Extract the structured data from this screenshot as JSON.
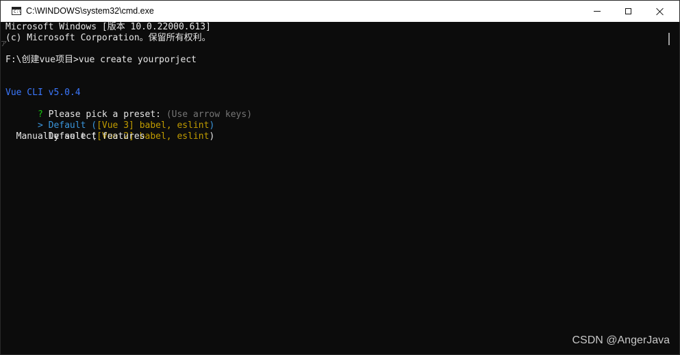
{
  "window": {
    "title": "C:\\WINDOWS\\system32\\cmd.exe",
    "icon": "cmd-icon",
    "icon_glyph": "C:\\",
    "buttons": {
      "minimize": "minimize-icon",
      "maximize": "maximize-icon",
      "close": "close-icon"
    }
  },
  "console": {
    "lines": {
      "l1": "Microsoft Windows [版本 10.0.22000.613]",
      "l2": "(c) Microsoft Corporation。保留所有权利。",
      "l3": "F:\\创建vue项目>vue create yourporject",
      "vue_cli": "Vue CLI v5.0.4",
      "question_mark": "?",
      "prompt_text": " Please pick a preset: ",
      "prompt_hint": "(Use arrow keys)",
      "opt1_pointer": ">",
      "opt1_label": " Default (",
      "opt1_tag": "[Vue 3] babel, eslint",
      "opt1_end": ")",
      "opt2_label": "  Default (",
      "opt2_tag": "[Vue 2] babel, eslint",
      "opt2_end": ")",
      "opt3_label": "  Manually select features"
    },
    "stray_mark": "ア"
  },
  "colors": {
    "background": "#0c0c0c",
    "text": "#cccccc",
    "blue": "#3b78ff",
    "green": "#16c60c",
    "gray": "#767676",
    "yellow": "#c19c00",
    "cyan": "#3a96dd"
  },
  "watermark": "CSDN @AngerJava"
}
